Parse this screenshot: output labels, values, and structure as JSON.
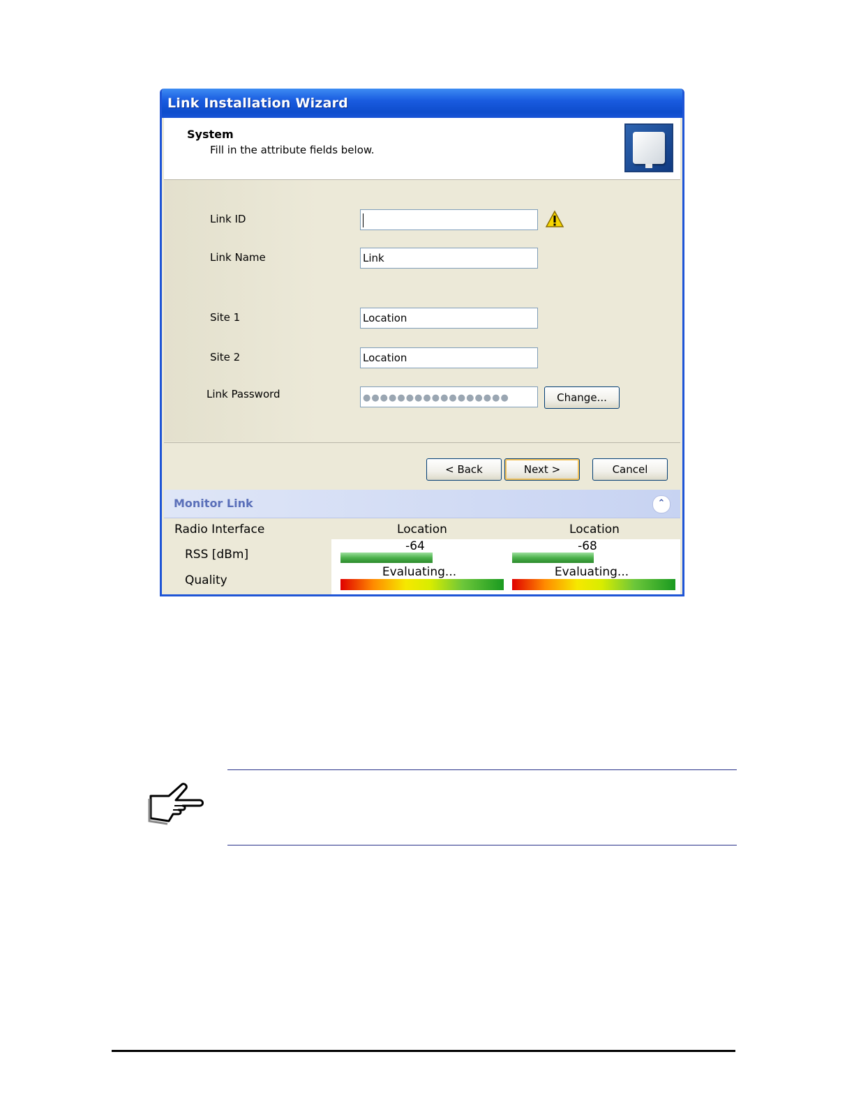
{
  "window": {
    "title": "Link Installation Wizard"
  },
  "header": {
    "title": "System",
    "subtitle": "Fill in the attribute fields below."
  },
  "form": {
    "link_id": {
      "label": "Link ID",
      "value": ""
    },
    "link_name": {
      "label": "Link Name",
      "value": "Link"
    },
    "site1": {
      "label": "Site 1",
      "value": "Location"
    },
    "site2": {
      "label": "Site 2",
      "value": "Location"
    },
    "link_password": {
      "label": "Link Password",
      "masked_value": "●●●●●●●●●●●●●●●●●",
      "change_label": "Change..."
    }
  },
  "buttons": {
    "back": "< Back",
    "next": "Next >",
    "cancel": "Cancel"
  },
  "monitor": {
    "title": "Monitor Link",
    "columns": {
      "interface": "Radio Interface",
      "site1": "Location",
      "site2": "Location"
    },
    "rows": {
      "rss": {
        "label": "RSS [dBm]",
        "site1": "-64",
        "site2": "-68"
      },
      "quality": {
        "label": "Quality",
        "site1": "Evaluating...",
        "site2": "Evaluating..."
      }
    }
  },
  "icons": {
    "warning": "warning-icon",
    "collapse": "chevron-double-up-icon",
    "note": "pointing-hand-icon",
    "header": "radio-unit-icon"
  },
  "colors": {
    "title_bar": "#1a5ce0",
    "monitor_title": "#5a6fb9",
    "rss_bar": "#4cb24c",
    "note_rule": "#28318a"
  }
}
